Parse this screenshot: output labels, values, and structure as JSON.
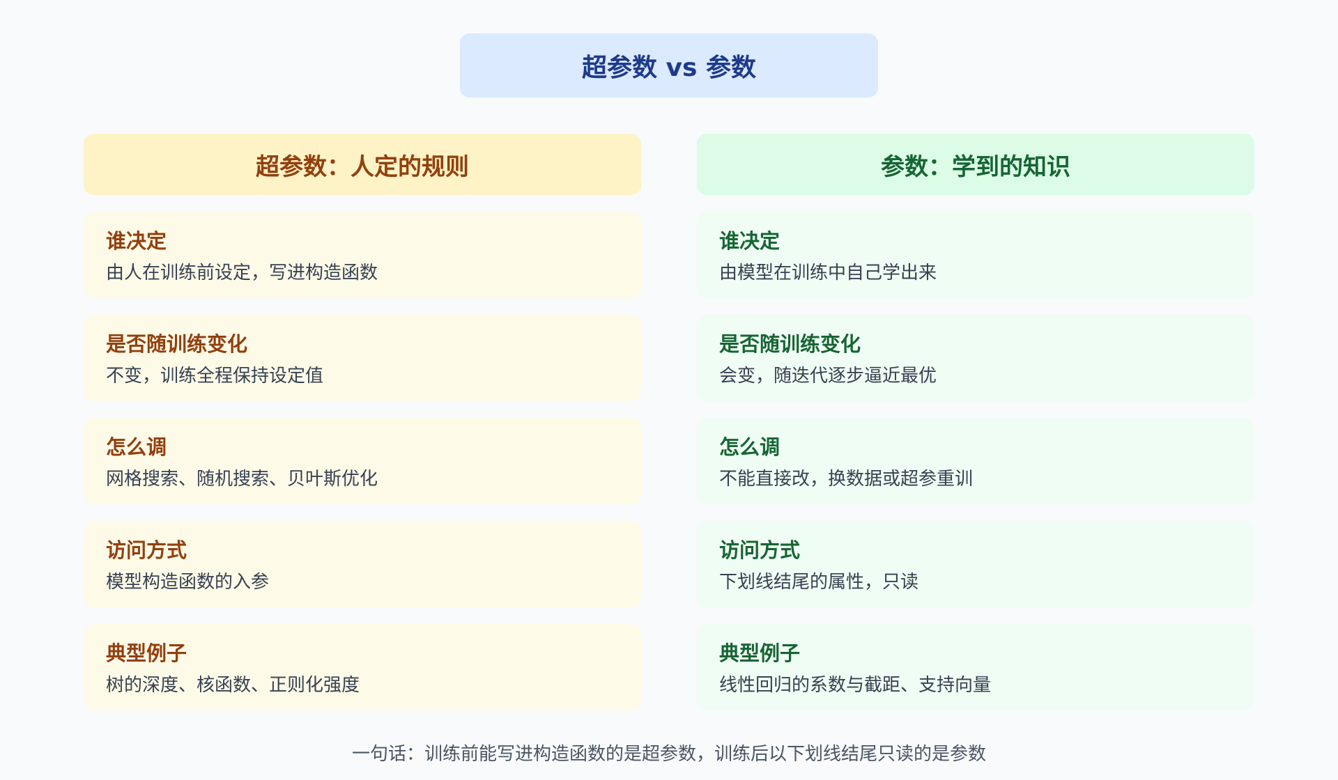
{
  "title": "超参数 vs 参数",
  "left": {
    "header": "超参数：人定的规则",
    "cards": [
      {
        "title": "谁决定",
        "body": "由人在训练前设定，写进构造函数"
      },
      {
        "title": "是否随训练变化",
        "body": "不变，训练全程保持设定值"
      },
      {
        "title": "怎么调",
        "body": "网格搜索、随机搜索、贝叶斯优化"
      },
      {
        "title": "访问方式",
        "body": "模型构造函数的入参"
      },
      {
        "title": "典型例子",
        "body": "树的深度、核函数、正则化强度"
      }
    ]
  },
  "right": {
    "header": "参数：学到的知识",
    "cards": [
      {
        "title": "谁决定",
        "body": "由模型在训练中自己学出来"
      },
      {
        "title": "是否随训练变化",
        "body": "会变，随迭代逐步逼近最优"
      },
      {
        "title": "怎么调",
        "body": "不能直接改，换数据或超参重训"
      },
      {
        "title": "访问方式",
        "body": "下划线结尾的属性，只读"
      },
      {
        "title": "典型例子",
        "body": "线性回归的系数与截距、支持向量"
      }
    ]
  },
  "footer": "一句话：训练前能写进构造函数的是超参数，训练后以下划线结尾只读的是参数",
  "colors": {
    "title_bg": "#dbeafe",
    "title_text": "#1e3a8a",
    "left_header_bg": "#fef3c7",
    "left_accent": "#92400e",
    "left_card_bg": "#fefae8",
    "right_header_bg": "#dcfce7",
    "right_accent": "#166534",
    "right_card_bg": "#f0fdf4"
  }
}
